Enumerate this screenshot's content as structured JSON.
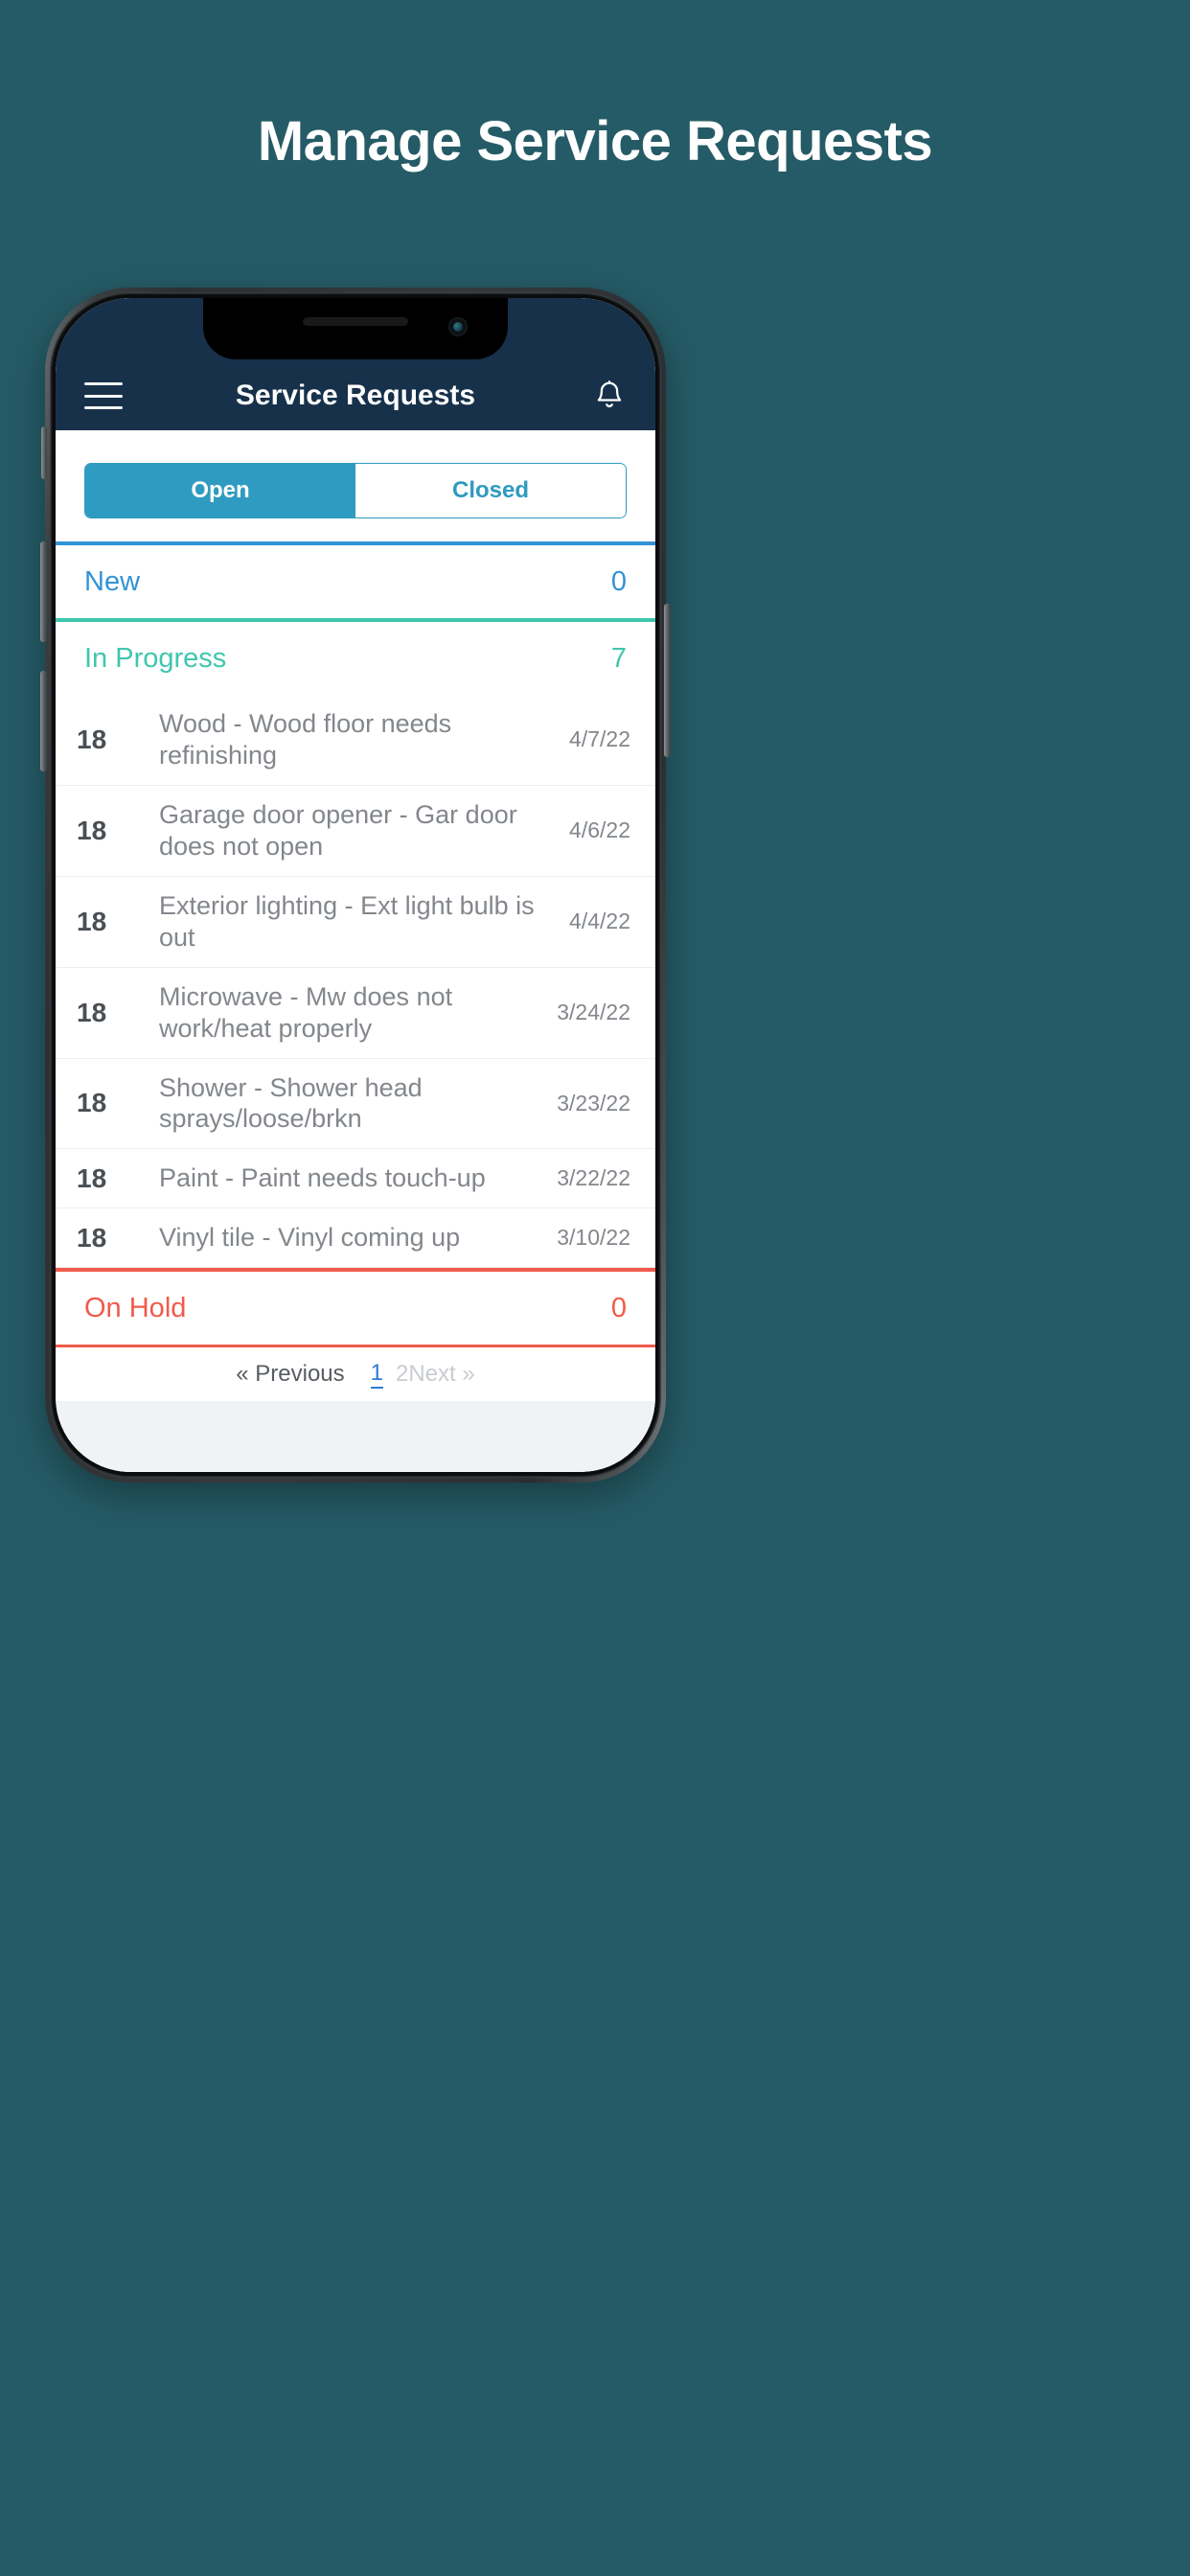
{
  "page": {
    "headline": "Manage Service Requests",
    "background_color": "#255b66"
  },
  "app_header": {
    "menu_icon": "hamburger-icon",
    "title": "Service Requests",
    "notification_icon": "bell-icon",
    "background_color": "#17314a"
  },
  "tabs": {
    "open_label": "Open",
    "closed_label": "Closed",
    "active": "Open",
    "accent_color": "#2f9bc0"
  },
  "groups": [
    {
      "label": "New",
      "count": "0",
      "color": "#3293d6"
    },
    {
      "label": "In Progress",
      "count": "7",
      "color": "#3fc6ae"
    },
    {
      "label": "On Hold",
      "count": "0",
      "color": "#f05a4b"
    }
  ],
  "requests": [
    {
      "id": "18",
      "title": "Wood - Wood floor needs refinishing",
      "date": "4/7/22"
    },
    {
      "id": "18",
      "title": "Garage door opener - Gar door does not open",
      "date": "4/6/22"
    },
    {
      "id": "18",
      "title": "Exterior lighting - Ext light bulb is out",
      "date": "4/4/22"
    },
    {
      "id": "18",
      "title": "Microwave - Mw does not work/heat properly",
      "date": "3/24/22"
    },
    {
      "id": "18",
      "title": "Shower - Shower head sprays/loose/brkn",
      "date": "3/23/22"
    },
    {
      "id": "18",
      "title": "Paint - Paint needs touch-up",
      "date": "3/22/22"
    },
    {
      "id": "18",
      "title": "Vinyl tile - Vinyl coming up",
      "date": "3/10/22"
    }
  ],
  "pagination": {
    "previous_label": "« Previous",
    "page_1": "1",
    "page_2": "2",
    "next_label": "Next »",
    "active_page": "1"
  }
}
